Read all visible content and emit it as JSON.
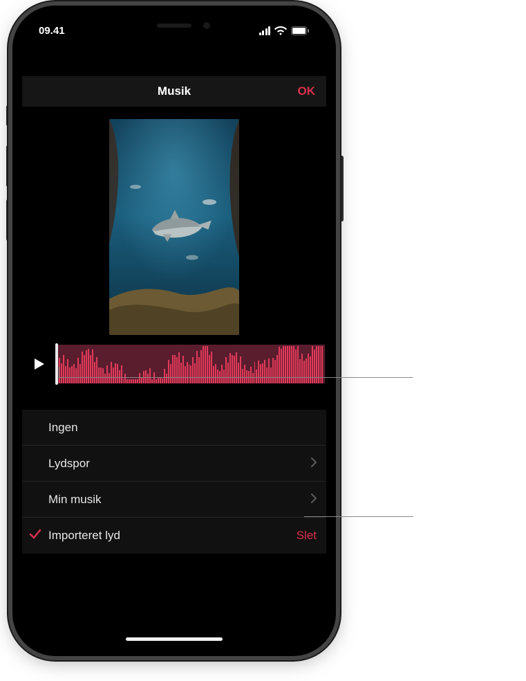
{
  "status": {
    "time": "09.41"
  },
  "nav": {
    "title": "Musik",
    "ok_label": "OK"
  },
  "list": {
    "none_label": "Ingen",
    "soundtrack_label": "Lydspor",
    "mymusic_label": "Min musik",
    "imported_label": "Importeret lyd",
    "delete_label": "Slet"
  },
  "colors": {
    "accent": "#d9304e",
    "waveform": "#e33a5a"
  }
}
